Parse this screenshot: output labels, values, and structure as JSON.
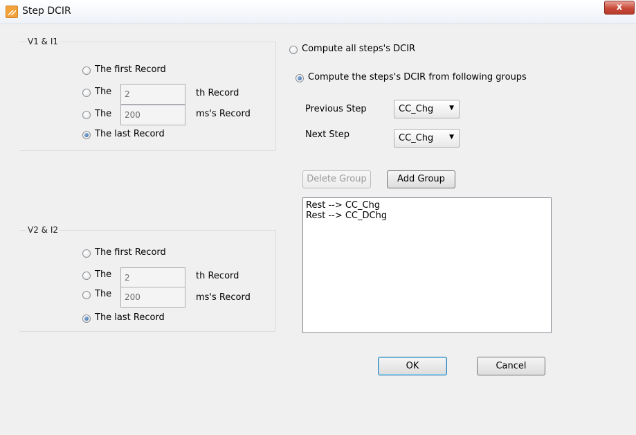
{
  "window": {
    "title": "Step DCIR",
    "close_glyph": "x"
  },
  "v1i1": {
    "title": "V1 & I1",
    "first_record_label": "The first Record",
    "the_label_1": "The",
    "nth_value": "2",
    "nth_suffix": "th Record",
    "the_label_2": "The",
    "ms_value": "200",
    "ms_suffix": "ms's Record",
    "last_record_label": "The last Record",
    "selected": "last"
  },
  "v2i2": {
    "title": "V2 & I2",
    "first_record_label": "The first Record",
    "the_label_1": "The",
    "nth_value": "2",
    "nth_suffix": "th Record",
    "the_label_2": "The",
    "ms_value": "200",
    "ms_suffix": "ms's Record",
    "last_record_label": "The last Record",
    "selected": "last"
  },
  "compute": {
    "all_label": "Compute all steps's DCIR",
    "groups_label": "Compute the steps's DCIR from following groups",
    "selected": "groups"
  },
  "previous_step": {
    "label": "Previous Step",
    "value": "CC_Chg"
  },
  "next_step": {
    "label": "Next Step",
    "value": "CC_Chg"
  },
  "buttons": {
    "delete_group": "Delete Group",
    "add_group": "Add Group",
    "ok": "OK",
    "cancel": "Cancel"
  },
  "groups_list": [
    "Rest --> CC_Chg",
    "Rest --> CC_DChg"
  ],
  "colors": {
    "close_red": "#c94b3a",
    "accent_blue": "#3c7fb1"
  }
}
